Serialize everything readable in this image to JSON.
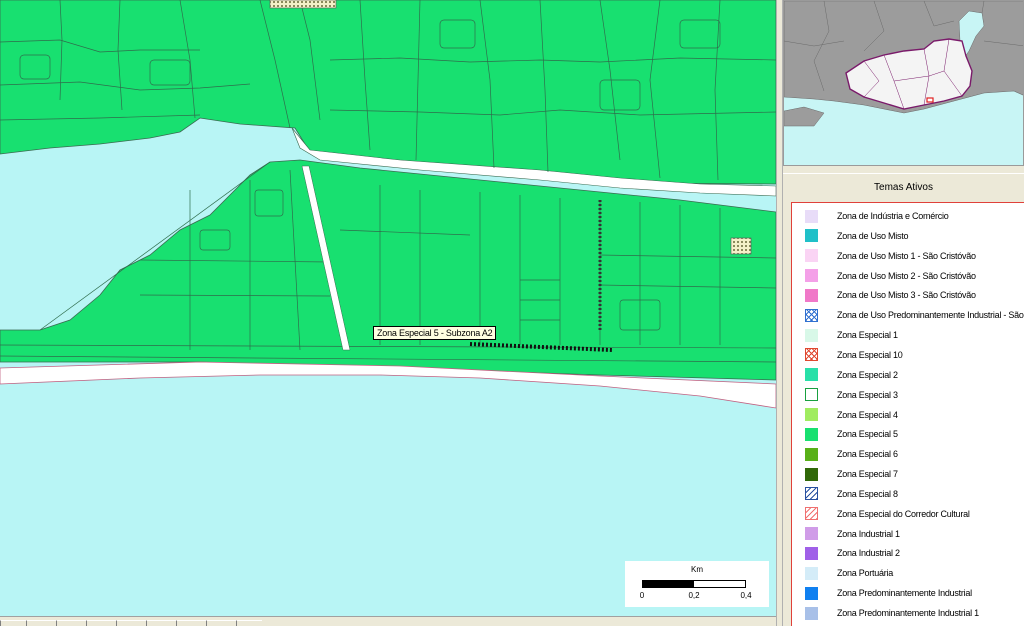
{
  "map": {
    "tooltip": "Zona Especial 5 - Subzona A2",
    "scalebar": {
      "unit": "Km",
      "ticks": [
        "0",
        "0,2",
        "0,4"
      ]
    }
  },
  "legend": {
    "title": "Temas Ativos",
    "items": [
      {
        "label": "Zona de Indústria e Comércio",
        "color": "#e8dcf8",
        "pattern": "solid"
      },
      {
        "label": "Zona de Uso Misto",
        "color": "#20c0c8",
        "pattern": "solid"
      },
      {
        "label": "Zona de Uso Misto 1 - São Cristóvão",
        "color": "#fad4f4",
        "pattern": "solid"
      },
      {
        "label": "Zona de Uso Misto 2 - São Cristóvão",
        "color": "#f4a0e8",
        "pattern": "solid"
      },
      {
        "label": "Zona de Uso Misto 3 - São Cristóvão",
        "color": "#f078c8",
        "pattern": "solid"
      },
      {
        "label": "Zona de Uso Predominantemente Industrial - São Cristóvão",
        "color": "#3070d0",
        "pattern": "crosshatch"
      },
      {
        "label": "Zona Especial 1",
        "color": "#d8f8e8",
        "pattern": "solid"
      },
      {
        "label": "Zona Especial 10",
        "color": "#e04830",
        "pattern": "crosshatch"
      },
      {
        "label": "Zona Especial 2",
        "color": "#28e0a8",
        "pattern": "solid"
      },
      {
        "label": "Zona Especial 3",
        "color": "#ffffff",
        "pattern": "outline",
        "stroke": "#18a040"
      },
      {
        "label": "Zona Especial 4",
        "color": "#a0ec60",
        "pattern": "solid"
      },
      {
        "label": "Zona Especial 5",
        "color": "#18e070",
        "pattern": "solid"
      },
      {
        "label": "Zona Especial 6",
        "color": "#58b018",
        "pattern": "solid"
      },
      {
        "label": "Zona Especial 7",
        "color": "#306808",
        "pattern": "solid"
      },
      {
        "label": "Zona Especial 8",
        "color": "#2850a0",
        "pattern": "diagonal"
      },
      {
        "label": "Zona Especial do Corredor Cultural",
        "color": "#f07070",
        "pattern": "diagonal"
      },
      {
        "label": "Zona Industrial 1",
        "color": "#d09ce8",
        "pattern": "solid"
      },
      {
        "label": "Zona Industrial 2",
        "color": "#a060e8",
        "pattern": "solid"
      },
      {
        "label": "Zona Portuária",
        "color": "#d4ecf8",
        "pattern": "solid"
      },
      {
        "label": "Zona Predominantemente Industrial",
        "color": "#1080f0",
        "pattern": "solid"
      },
      {
        "label": "Zona Predominantemente Industrial 1",
        "color": "#a8c0e8",
        "pattern": "solid"
      }
    ]
  }
}
